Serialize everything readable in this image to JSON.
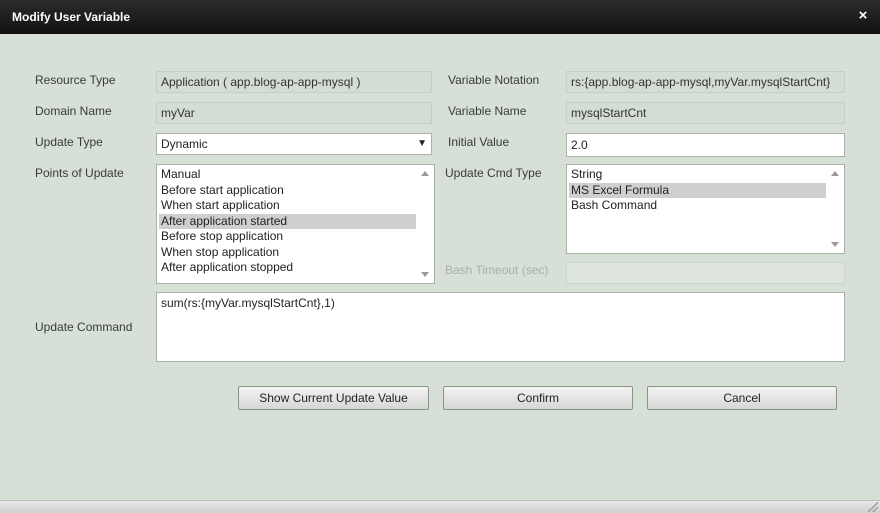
{
  "dialog": {
    "title": "Modify User Variable",
    "close_glyph": "×"
  },
  "form": {
    "resource_type": {
      "label": "Resource Type",
      "value": "Application ( app.blog-ap-app-mysql )"
    },
    "variable_notation": {
      "label": "Variable Notation",
      "value": "rs:{app.blog-ap-app-mysql,myVar.mysqlStartCnt}"
    },
    "domain_name": {
      "label": "Domain Name",
      "value": "myVar"
    },
    "variable_name": {
      "label": "Variable Name",
      "value": "mysqlStartCnt"
    },
    "update_type": {
      "label": "Update Type",
      "value": "Dynamic"
    },
    "initial_value": {
      "label": "Initial Value",
      "value": "2.0"
    },
    "points_of_update": {
      "label": "Points of Update",
      "items": [
        "Manual",
        "Before start application",
        "When start application",
        "After application started",
        "Before stop application",
        "When stop application",
        "After application stopped"
      ],
      "selected": "After application started"
    },
    "update_cmd_type": {
      "label": "Update Cmd Type",
      "items": [
        "String",
        "MS Excel Formula",
        "Bash Command"
      ],
      "selected": "MS Excel Formula"
    },
    "bash_timeout": {
      "label": "Bash Timeout (sec)",
      "value": ""
    },
    "update_command": {
      "label": "Update Command",
      "value": "sum(rs:{myVar.mysqlStartCnt},1)"
    }
  },
  "buttons": {
    "show_current": "Show Current Update Value",
    "confirm": "Confirm",
    "cancel": "Cancel"
  },
  "icons": {
    "dropdown": "▼"
  }
}
